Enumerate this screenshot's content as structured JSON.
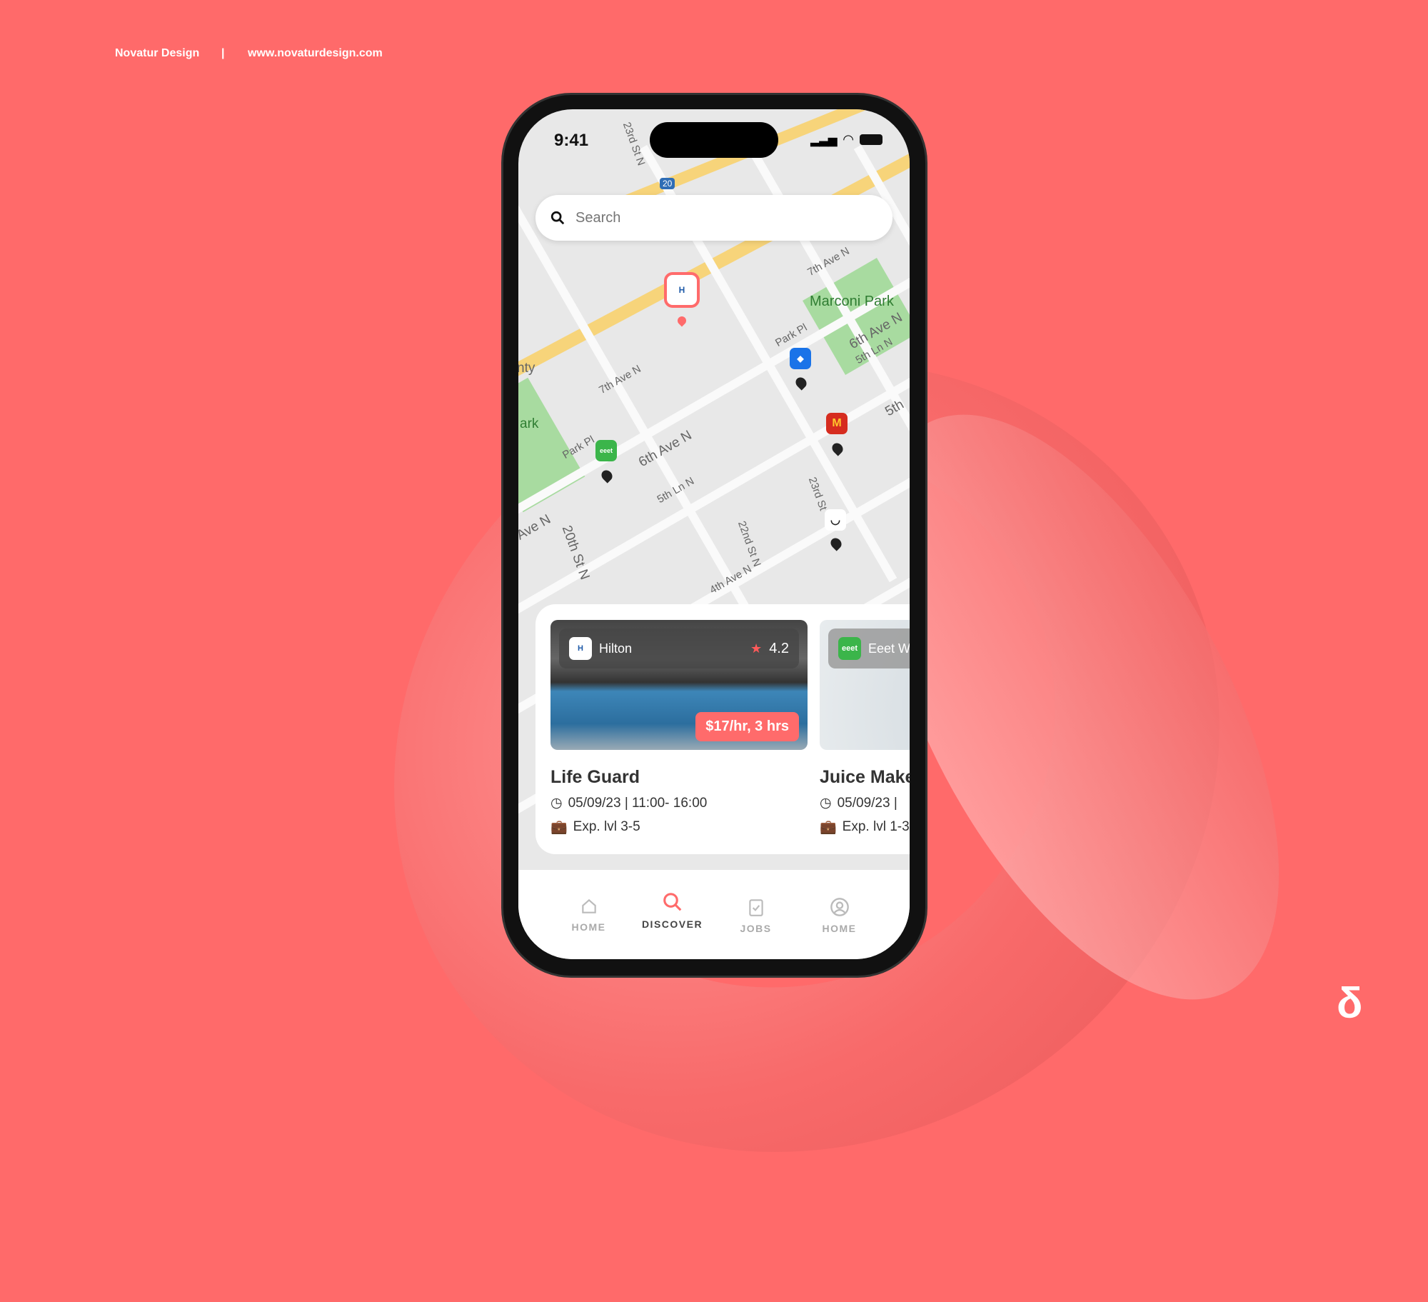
{
  "branding": {
    "studio": "Novatur Design",
    "separator": "|",
    "website": "www.novaturdesign.com",
    "logo_mark": "δ"
  },
  "status_bar": {
    "time": "9:41"
  },
  "search": {
    "placeholder": "Search"
  },
  "map": {
    "labels": [
      "23rd St N",
      "7th Ave N",
      "Marconi Park",
      "Park Pl",
      "6th Ave N",
      "5th Ln N",
      "5th",
      "7th Ave N",
      "Park Pl",
      "6th Ave N",
      "5th Ln N",
      "23rd St",
      "22nd St N",
      "20th St N",
      "4th Ave N",
      "Ave N",
      "ark",
      "nty",
      "20"
    ],
    "pins": [
      {
        "brand": "Hilton",
        "color": "#ff6b6b",
        "selected": true
      },
      {
        "brand": "blue-place",
        "color": "#1a73e8"
      },
      {
        "brand": "McDonald's",
        "color": "#d62c1f"
      },
      {
        "brand": "Eeet Well",
        "color": "#3bb54a"
      },
      {
        "brand": "smile",
        "color": "#ffffff"
      }
    ]
  },
  "jobs": [
    {
      "company": "Hilton",
      "rating": "4.2",
      "price": "$17/hr, 3 hrs",
      "title": "Life Guard",
      "schedule": "05/09/23 | 11:00- 16:00",
      "experience": "Exp. lvl 3-5"
    },
    {
      "company": "Eeet Well",
      "title": "Juice Maker",
      "schedule": "05/09/23 |",
      "experience": "Exp. lvl 1-3"
    }
  ],
  "nav": [
    {
      "label": "HOME",
      "icon": "home-icon"
    },
    {
      "label": "DISCOVER",
      "icon": "search-icon",
      "active": true
    },
    {
      "label": "JOBS",
      "icon": "clipboard-icon"
    },
    {
      "label": "HOME",
      "icon": "profile-icon"
    }
  ],
  "colors": {
    "accent": "#ff6b6b",
    "background": "#ff6a6a"
  }
}
